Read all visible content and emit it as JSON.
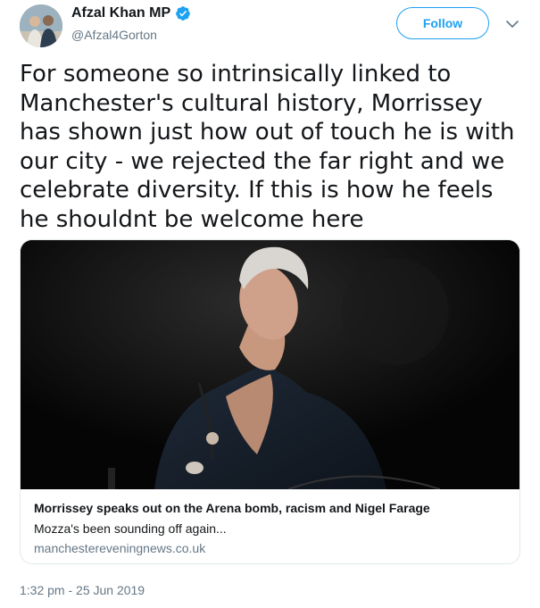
{
  "author": {
    "display_name": "Afzal Khan MP",
    "handle": "@Afzal4Gorton",
    "verified": true,
    "avatar": "profile-avatar"
  },
  "actions": {
    "follow_label": "Follow",
    "more_icon": "chevron-down-icon"
  },
  "tweet": {
    "text": "For someone so intrinsically linked to Manchester's cultural history, Morrissey has shown just how out of touch he is with our city - we rejected the far right and we celebrate diversity. If this is how he feels he shouldnt be welcome here",
    "timestamp": "1:32 pm - 25 Jun 2019"
  },
  "link_card": {
    "image": "photo-of-singer-on-stage",
    "title": "Morrissey speaks out on the Arena bomb, racism and Nigel Farage",
    "description": "Mozza's been sounding off again...",
    "domain": "manchestereveningnews.co.uk"
  },
  "colors": {
    "accent": "#1da1f2",
    "muted_text": "#657786",
    "text": "#14171a",
    "border": "#e1e8ed"
  }
}
